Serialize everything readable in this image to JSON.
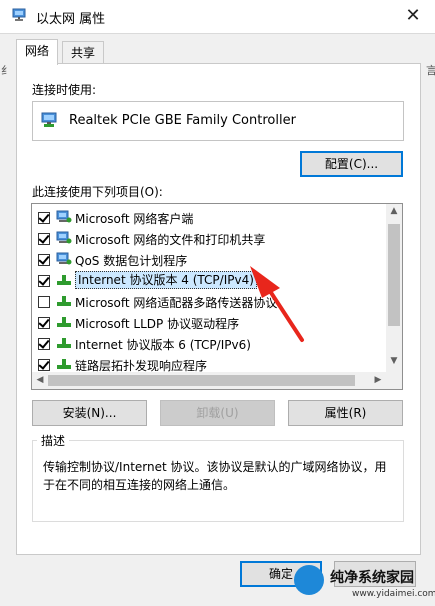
{
  "window": {
    "title": "以太网 属性",
    "close_glyph": "✕"
  },
  "tabs": [
    {
      "label": "网络",
      "active": true
    },
    {
      "label": "共享",
      "active": false
    }
  ],
  "background_letters": [
    "纟",
    "言"
  ],
  "connect_using": {
    "label": "连接时使用:",
    "adapter": "Realtek PCIe GBE Family Controller",
    "configure_button": "配置(C)..."
  },
  "items_section": {
    "label": "此连接使用下列项目(O):",
    "items": [
      {
        "label": "Microsoft 网络客户端",
        "checked": true,
        "icon": "network-client-icon",
        "selected": false
      },
      {
        "label": "Microsoft 网络的文件和打印机共享",
        "checked": true,
        "icon": "file-printer-sharing-icon",
        "selected": false
      },
      {
        "label": "QoS 数据包计划程序",
        "checked": true,
        "icon": "qos-scheduler-icon",
        "selected": false
      },
      {
        "label": "Internet 协议版本 4 (TCP/IPv4)",
        "checked": true,
        "icon": "protocol-icon",
        "selected": true
      },
      {
        "label": "Microsoft 网络适配器多路传送器协议",
        "checked": false,
        "icon": "protocol-icon",
        "selected": false
      },
      {
        "label": "Microsoft LLDP 协议驱动程序",
        "checked": true,
        "icon": "protocol-icon",
        "selected": false
      },
      {
        "label": "Internet 协议版本 6 (TCP/IPv6)",
        "checked": true,
        "icon": "protocol-icon",
        "selected": false
      },
      {
        "label": "链路层拓扑发现响应程序",
        "checked": true,
        "icon": "protocol-icon",
        "selected": false
      }
    ]
  },
  "buttons": {
    "install": "安装(N)...",
    "uninstall": "卸载(U)",
    "properties": "属性(R)"
  },
  "description": {
    "title": "描述",
    "text": "传输控制协议/Internet 协议。该协议是默认的广域网络协议，用于在不同的相互连接的网络上通信。"
  },
  "footer": {
    "ok": "确定"
  },
  "watermark": {
    "name": "纯净系统家园",
    "url": "www.yidaimei.com"
  },
  "annotation_color": "#e8261c",
  "colors": {
    "selection": "#cce8ff",
    "focus_border": "#0078d7",
    "protocol_green": "#2e9b2e"
  }
}
